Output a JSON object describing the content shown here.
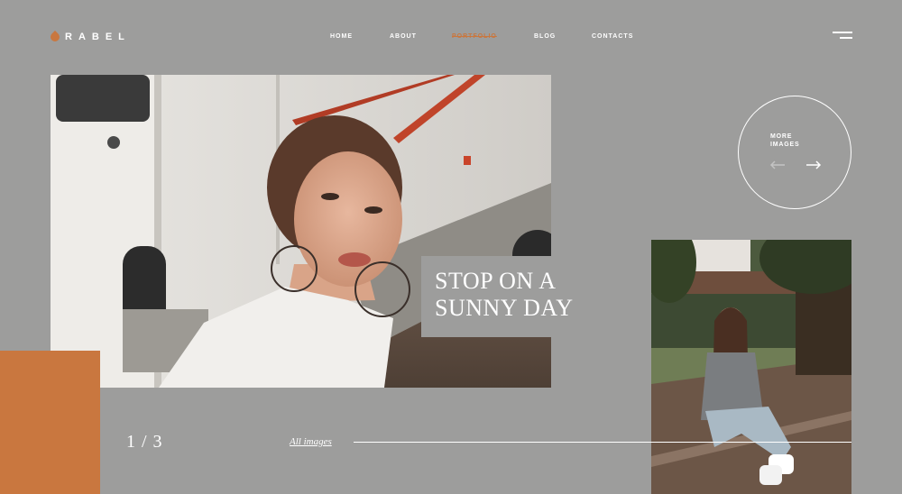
{
  "header": {
    "logo_text": "RABEL",
    "nav": [
      {
        "label": "HOME",
        "active": false
      },
      {
        "label": "ABOUT",
        "active": false
      },
      {
        "label": "PORTFOLIO",
        "active": true
      },
      {
        "label": "BLOG",
        "active": false
      },
      {
        "label": "CONTACTS",
        "active": false
      }
    ]
  },
  "hero": {
    "title_line1": "STOP ON A",
    "title_line2": "SUNNY DAY"
  },
  "more": {
    "label_line1": "MORE",
    "label_line2": "IMAGES"
  },
  "footer": {
    "counter": "1 / 3",
    "all_images": "All images"
  },
  "colors": {
    "background": "#9d9d9c",
    "accent": "#c9773f",
    "text": "#ffffff"
  },
  "icons": {
    "logo": "logo-mark-icon",
    "menu": "hamburger-menu-icon",
    "prev": "arrow-left-icon",
    "next": "arrow-right-icon"
  }
}
